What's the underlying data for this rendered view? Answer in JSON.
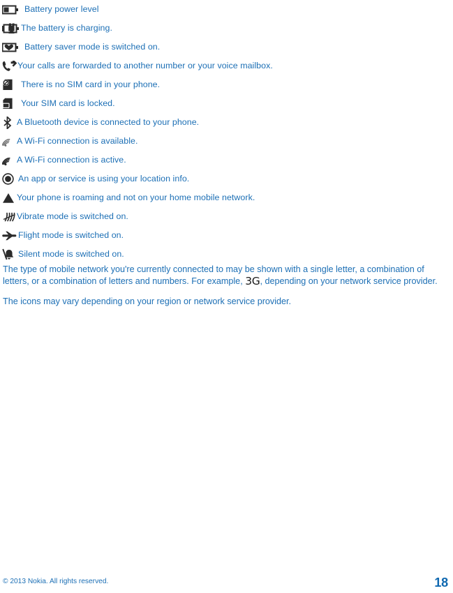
{
  "colors": {
    "text_blue": "#1c6fb5",
    "page_number_blue": "#0f68b0",
    "icon_dark": "#2b2b2b",
    "background": "#ffffff"
  },
  "icon_list": [
    {
      "icon": "battery-icon",
      "label": "Battery power level"
    },
    {
      "icon": "battery-charging-icon",
      "label": "The battery is charging."
    },
    {
      "icon": "battery-saver-icon",
      "label": "Battery saver mode is switched on."
    },
    {
      "icon": "call-forward-icon",
      "label": "Your calls are forwarded to another number or your voice mailbox."
    },
    {
      "icon": "no-sim-card-icon",
      "label": "There is no SIM card in your phone."
    },
    {
      "icon": "sim-locked-icon",
      "label": "Your SIM card is locked."
    },
    {
      "icon": "bluetooth-icon",
      "label": "A Bluetooth device is connected to your phone."
    },
    {
      "icon": "wifi-available-icon",
      "label": "A Wi-Fi connection is available."
    },
    {
      "icon": "wifi-active-icon",
      "label": "A Wi-Fi connection is active."
    },
    {
      "icon": "location-icon",
      "label": "An app or service is using your location info."
    },
    {
      "icon": "roaming-icon",
      "label": "Your phone is roaming and not on your home mobile network."
    },
    {
      "icon": "vibrate-icon",
      "label": "Vibrate mode is switched on."
    },
    {
      "icon": "flight-mode-icon",
      "label": "Flight mode is switched on."
    },
    {
      "icon": "silent-mode-icon",
      "label": "Silent mode is switched on."
    }
  ],
  "body": {
    "paragraph_1_part_1": "The type of mobile network you're currently connected to may be shown with a single letter, a combination of letters, or a combination of letters and numbers. For example, ",
    "paragraph_1_network_badge": "3G",
    "paragraph_1_part_2": ", depending on your network service provider.",
    "paragraph_2": "The icons may vary depending on your region or network service provider."
  },
  "footer": {
    "copyright": "© 2013 Nokia. All rights reserved.",
    "page_number": "18"
  }
}
